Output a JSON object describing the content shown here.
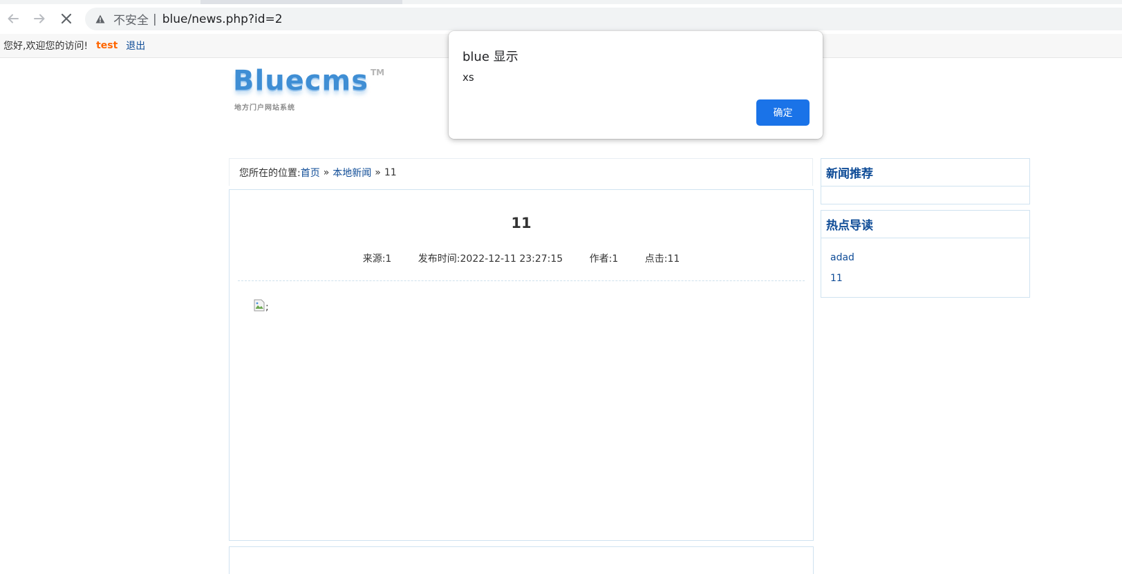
{
  "browser": {
    "security_label": "不安全",
    "separator": "|",
    "url": "blue/news.php?id=2"
  },
  "topbar": {
    "greeting": "您好,欢迎您的访问!",
    "username": "test",
    "logout": "退出"
  },
  "logo": {
    "name": "Bluecms",
    "trademark": "TM",
    "tagline": "地方门户网站系统"
  },
  "breadcrumb": {
    "label": "您所在的位置:",
    "home": "首页",
    "sep": "»",
    "category": "本地新闻",
    "current": "11"
  },
  "article": {
    "title": "11",
    "source": "来源:1",
    "published": "发布时间:2022-12-11 23:27:15",
    "author": "作者:1",
    "clicks": "点击:11",
    "broken_image_alt": ";"
  },
  "sidebar": {
    "recommend_title": "新闻推荐",
    "hot_title": "热点导读",
    "hot_items": [
      "adad",
      "11"
    ]
  },
  "dialog": {
    "title": "blue 显示",
    "message": "xs",
    "ok": "确定"
  },
  "colors": {
    "link": "#0f4c97",
    "username": "#ff6600",
    "dialog_button": "#1a73e8",
    "border": "#cfe2f0"
  }
}
